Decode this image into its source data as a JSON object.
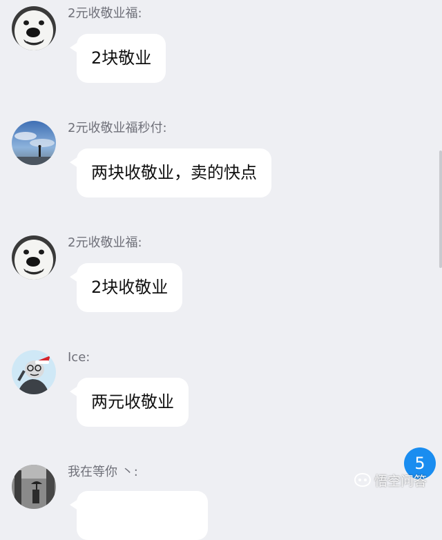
{
  "messages": [
    {
      "sender": "2元收敬业福:",
      "text": "2块敬业",
      "avatar": "white-dog-avatar"
    },
    {
      "sender": "2元收敬业福秒付:",
      "text": "两块收敬业，卖的快点",
      "avatar": "sky-person-avatar"
    },
    {
      "sender": "2元收敬业福:",
      "text": "2块收敬业",
      "avatar": "white-dog-avatar"
    },
    {
      "sender": "Ice:",
      "text": "两元收敬业",
      "avatar": "cartoon-santa-hat-avatar"
    },
    {
      "sender": "我在等你 丶:",
      "text": "",
      "avatar": "bw-street-avatar"
    }
  ],
  "unread_badge": "5",
  "watermark": {
    "text": "悟空问答",
    "logo": "wukong-logo-icon"
  },
  "colors": {
    "background": "#eeeff3",
    "bubble": "#ffffff",
    "badge": "#1a8df0",
    "sender": "#6f7079"
  }
}
